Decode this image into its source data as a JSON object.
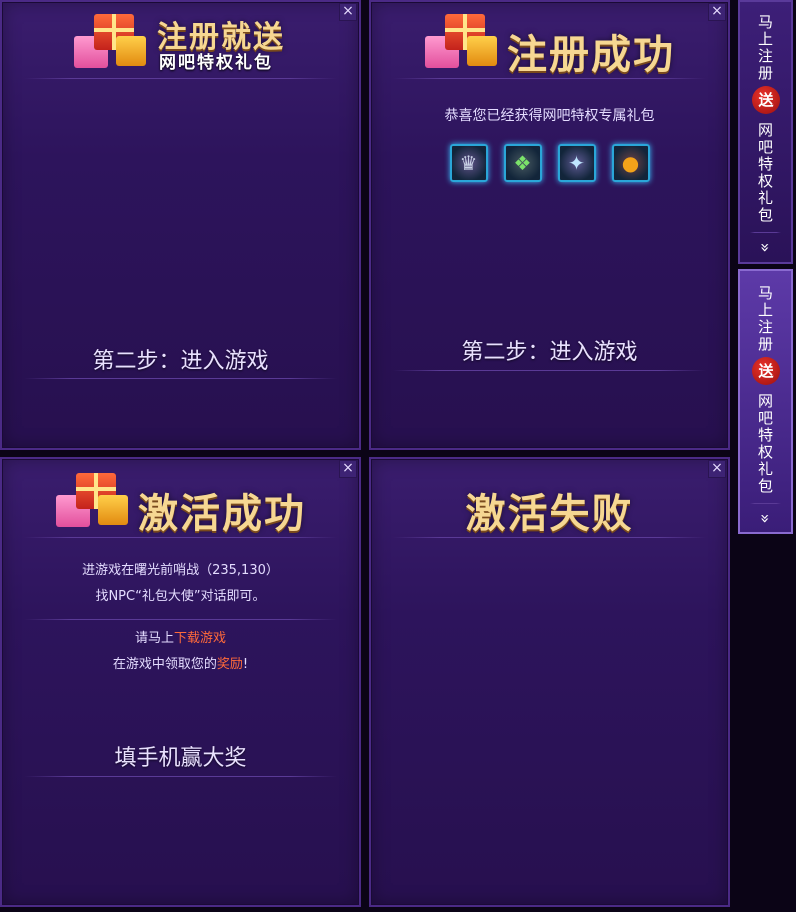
{
  "panel1": {
    "title_main": "注册就送",
    "title_sub": "网吧特权礼包",
    "step": "第二步：进入游戏",
    "close": "×"
  },
  "panel2": {
    "title": "注册成功",
    "message": "恭喜您已经获得网吧特权专属礼包",
    "step": "第二步：进入游戏",
    "close": "×",
    "items": [
      {
        "icon": "crown-medal-icon",
        "glyph": "♛",
        "color": "#c9d2e6"
      },
      {
        "icon": "green-gem-icon",
        "glyph": "❖",
        "color": "#7be36a"
      },
      {
        "icon": "ice-crystal-icon",
        "glyph": "✦",
        "color": "#bfe6ff"
      },
      {
        "icon": "golden-orb-icon",
        "glyph": "●",
        "color": "#f3a21a"
      }
    ]
  },
  "panel3": {
    "title": "激活成功",
    "line1": "进游戏在曙光前哨战（235,130）",
    "line2": "找NPC“礼包大使”对话即可。",
    "line3_pre": "请马上",
    "line3_link": "下载游戏",
    "line4_pre": "在游戏中领取您的",
    "line4_link": "奖励",
    "line4_post": "!",
    "step": "填手机赢大奖",
    "close": "×"
  },
  "panel4": {
    "title": "激活失败",
    "close": "×"
  },
  "sidebar": {
    "tab1": {
      "top": "马\n上\n注\n册",
      "badge": "送",
      "bottom": "网\n吧\n特\n权\n礼\n包",
      "chev": "»"
    },
    "tab2": {
      "top": "马\n上\n注\n册",
      "badge": "送",
      "bottom": "网\n吧\n特\n权\n礼\n包",
      "chev": "»"
    }
  },
  "colors": {
    "accent": "#f6d792",
    "highlight": "#ff6a3a",
    "badge": "#c4201a"
  }
}
